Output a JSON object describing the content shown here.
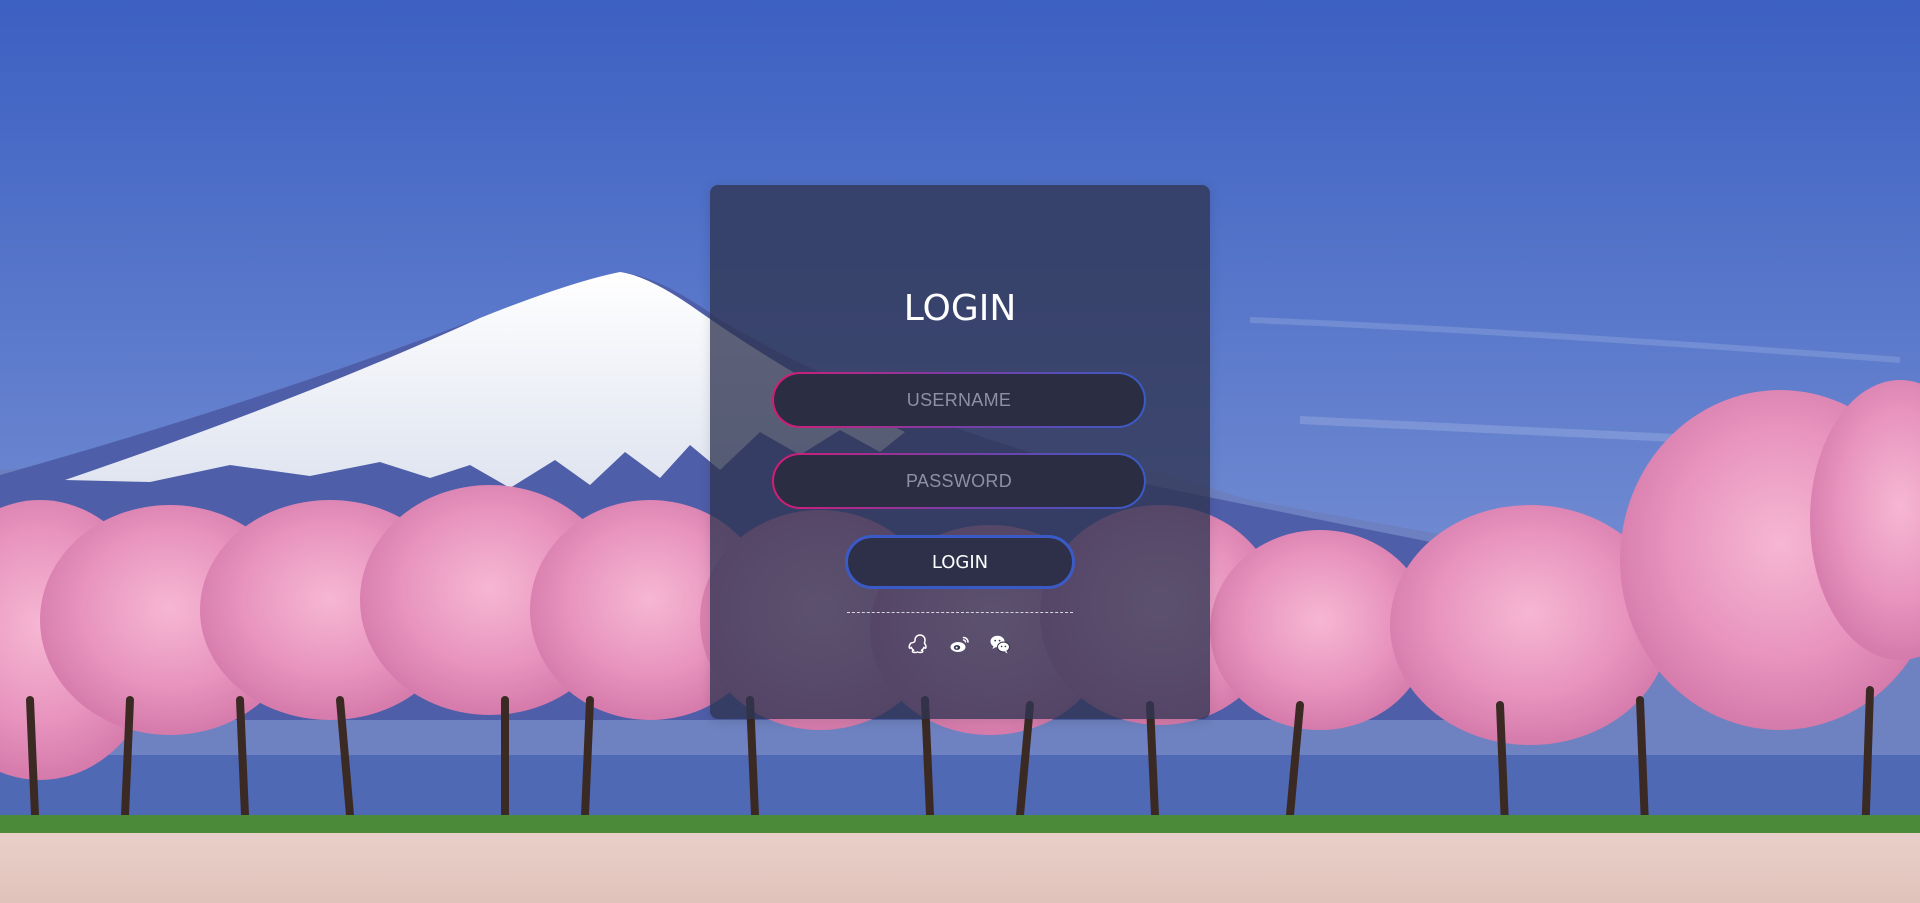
{
  "login": {
    "title": "LOGIN",
    "username_placeholder": "USERNAME",
    "password_placeholder": "PASSWORD",
    "button_label": "LOGIN"
  },
  "social": [
    "qq-icon",
    "weibo-icon",
    "wechat-icon"
  ],
  "colors": {
    "card": "#303452",
    "field_gradient_start": "#d51c75",
    "field_gradient_end": "#3a5bc7",
    "button_border": "#3a5bc7",
    "text": "#ffffff"
  }
}
